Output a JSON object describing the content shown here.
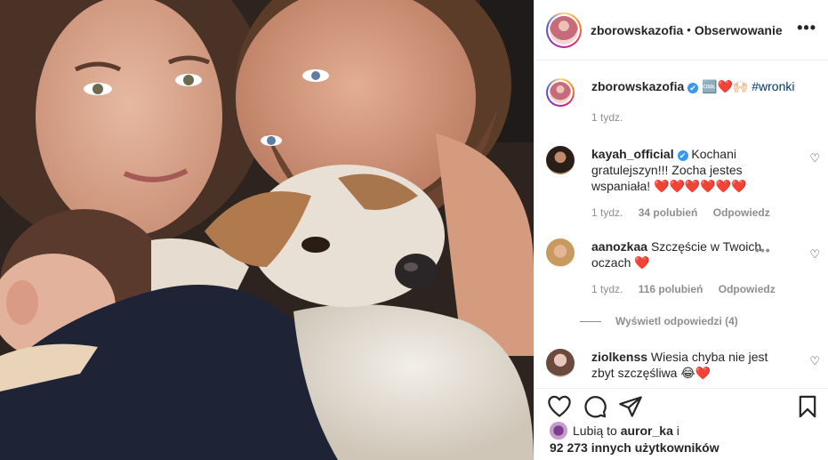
{
  "header": {
    "username": "zborowskazofia",
    "separator": "•",
    "follow_label": "Obserwowanie",
    "more_icon": "more-horizontal-icon"
  },
  "caption": {
    "username": "zborowskazofia",
    "verified": "✔",
    "text_emoji": "🆒❤️🙌🏻",
    "hashtag": "#wronki",
    "time": "1 tydz."
  },
  "comments": [
    {
      "username": "kayah_official",
      "verified": "✔",
      "text": "Kochani gratulejszyn!!! Zocha jestes wspaniała!",
      "emoji": "❤️❤️❤️❤️❤️❤️",
      "time": "1 tydz.",
      "likes": "34 polubień",
      "reply": "Odpowiedz"
    },
    {
      "username": "aanozkaa",
      "text": "Szczęście w Twoich oczach",
      "emoji": "❤️",
      "time": "1 tydz.",
      "likes": "116 polubień",
      "reply": "Odpowiedz",
      "more": "•••",
      "view_replies": "Wyświetl odpowiedzi (4)"
    },
    {
      "username": "ziolkenss",
      "text": "Wiesia chyba nie jest zbyt szczęśliwa",
      "emoji": "😂❤️"
    }
  ],
  "likes": {
    "prefix": "Lubią to",
    "user": "auror_ka",
    "conj": "i",
    "count": "92 273 innych użytkowników"
  },
  "colors": {
    "text": "#262626",
    "muted": "#8e8e8e",
    "verified": "#3897f0",
    "hashtag": "#00376b",
    "heart": "#ed4956"
  }
}
